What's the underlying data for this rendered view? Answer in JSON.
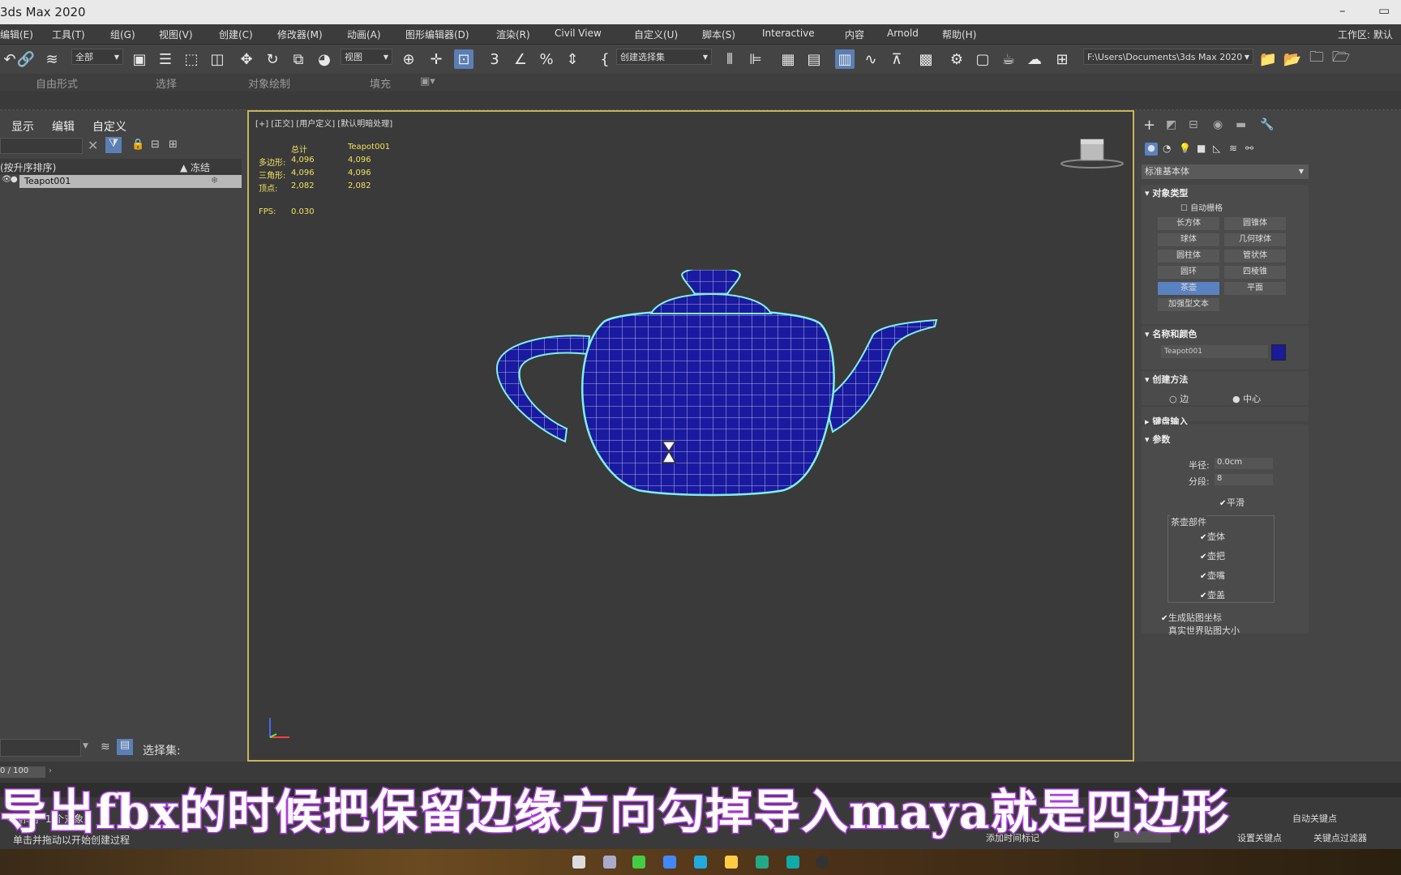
{
  "titlebar": {
    "title": "3ds Max 2020",
    "minimize": "–",
    "restore": "▭"
  },
  "menu": [
    "编辑(E)",
    "工具(T)",
    "组(G)",
    "视图(V)",
    "创建(C)",
    "修改器(M)",
    "动画(A)",
    "图形编辑器(D)",
    "渲染(R)",
    "Civil View",
    "自定义(U)",
    "脚本(S)",
    "Interactive",
    "内容",
    "Arnold",
    "帮助(H)"
  ],
  "menu_right": "工作区: 默认",
  "toolbar": {
    "select_filter": "全部",
    "ref_coord": "视图",
    "selection_set": "创建选择集",
    "path": "F:\\Users\\Documents\\3ds Max 2020"
  },
  "ribbon": [
    "自由形式",
    "选择",
    "对象绘制",
    "填充"
  ],
  "left_panel": {
    "menus": [
      "显示",
      "编辑",
      "自定义"
    ],
    "header_name": "(按升序排序)",
    "header_frozen": "▲ 冻结",
    "row": "Teapot001",
    "selection_set_label": "选择集:"
  },
  "viewport": {
    "label": "[+] [正交] [用户定义] [默认明暗处理]",
    "stats": {
      "col_total": "总计",
      "col_obj": "Teapot001",
      "rows": [
        {
          "label": "多边形:",
          "total": "4,096",
          "obj": "4,096"
        },
        {
          "label": "三角形:",
          "total": "4,096",
          "obj": "4,096"
        },
        {
          "label": "顶点:",
          "total": "2,082",
          "obj": "2,082"
        }
      ],
      "fps_label": "FPS:",
      "fps": "0.030"
    },
    "object_color": "#1a1aa0",
    "wire_color": "#7ff0e8"
  },
  "right_panel": {
    "category": "标准基本体",
    "sec_object_type": "对象类型",
    "auto_grid": "自动栅格",
    "buttons": [
      "长方体",
      "圆锥体",
      "球体",
      "几何球体",
      "圆柱体",
      "管状体",
      "圆环",
      "四棱锥",
      "茶壶",
      "平面",
      "加强型文本"
    ],
    "active_button": "茶壶",
    "sec_name_color": "名称和颜色",
    "name_value": "Teapot001",
    "color_swatch": "#1a1a9a",
    "sec_creation": "创建方法",
    "creation_edge": "边",
    "creation_center": "中心",
    "sec_keyboard": "键盘输入",
    "sec_params": "参数",
    "radius_label": "半径:",
    "radius_value": "0.0cm",
    "segments_label": "分段:",
    "segments_value": "8",
    "smooth": "平滑",
    "parts_title": "茶壶部件",
    "parts": [
      "壶体",
      "壶把",
      "壶嘴",
      "壶盖"
    ],
    "gen_mapping": "生成贴图坐标",
    "real_world": "真实世界贴图大小"
  },
  "bottom": {
    "frame": "0 / 100",
    "status": "选择了 1 个对象",
    "prompt": "单击并拖动以开始创建过程",
    "add_tag": "添加时间标记",
    "set_key": "设置关键点",
    "key_filter": "关键点过滤器",
    "auto_key": "自动关键点",
    "frame_value": "0"
  },
  "subtitle": "导出fbx的时候把保留边缘方向勾掉导入maya就是四边形"
}
